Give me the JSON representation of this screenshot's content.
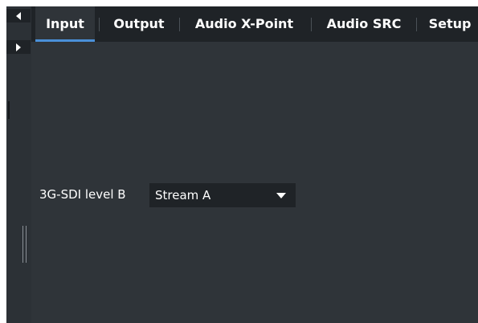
{
  "nav": {
    "prev_icon": "triangle-left-icon",
    "next_icon": "triangle-right-icon"
  },
  "tabs": [
    {
      "label": "Input",
      "active": true
    },
    {
      "label": "Output",
      "active": false
    },
    {
      "label": "Audio X-Point",
      "active": false
    },
    {
      "label": "Audio SRC",
      "active": false
    },
    {
      "label": "Setup",
      "active": false
    }
  ],
  "content": {
    "field_label": "3G-SDI level B",
    "select_value": "Stream A",
    "select_icon": "chevron-down-icon"
  },
  "colors": {
    "background": "#2f3439",
    "tabbar": "#1f2327",
    "active_tab_underline": "#4a90d9",
    "text": "#ffffff"
  }
}
